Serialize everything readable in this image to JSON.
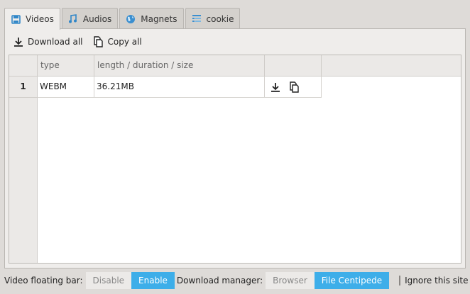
{
  "tabs": [
    {
      "label": "Videos",
      "icon": "video-icon",
      "active": true
    },
    {
      "label": "Audios",
      "icon": "music-note-icon",
      "active": false
    },
    {
      "label": "Magnets",
      "icon": "globe-icon",
      "active": false
    },
    {
      "label": "cookie",
      "icon": "cookie-list-icon",
      "active": false
    }
  ],
  "toolbar": {
    "download_all": "Download all",
    "copy_all": "Copy all"
  },
  "table": {
    "columns": [
      "type",
      "length / duration / size",
      ""
    ],
    "rows": [
      {
        "num": "1",
        "type": "WEBM",
        "size": "36.21MB"
      }
    ]
  },
  "bottom": {
    "floating_bar_label": "Video floating bar:",
    "floating_bar_options": [
      "Disable",
      "Enable"
    ],
    "floating_bar_selected": "Enable",
    "download_manager_label": "Download manager:",
    "download_manager_options": [
      "Browser",
      "File Centipede"
    ],
    "download_manager_selected": "File Centipede",
    "ignore_site_label": "Ignore this site",
    "ignore_site_checked": false
  },
  "colors": {
    "accent": "#3daee9",
    "background": "#dedbd8",
    "panel": "#efedeb"
  }
}
